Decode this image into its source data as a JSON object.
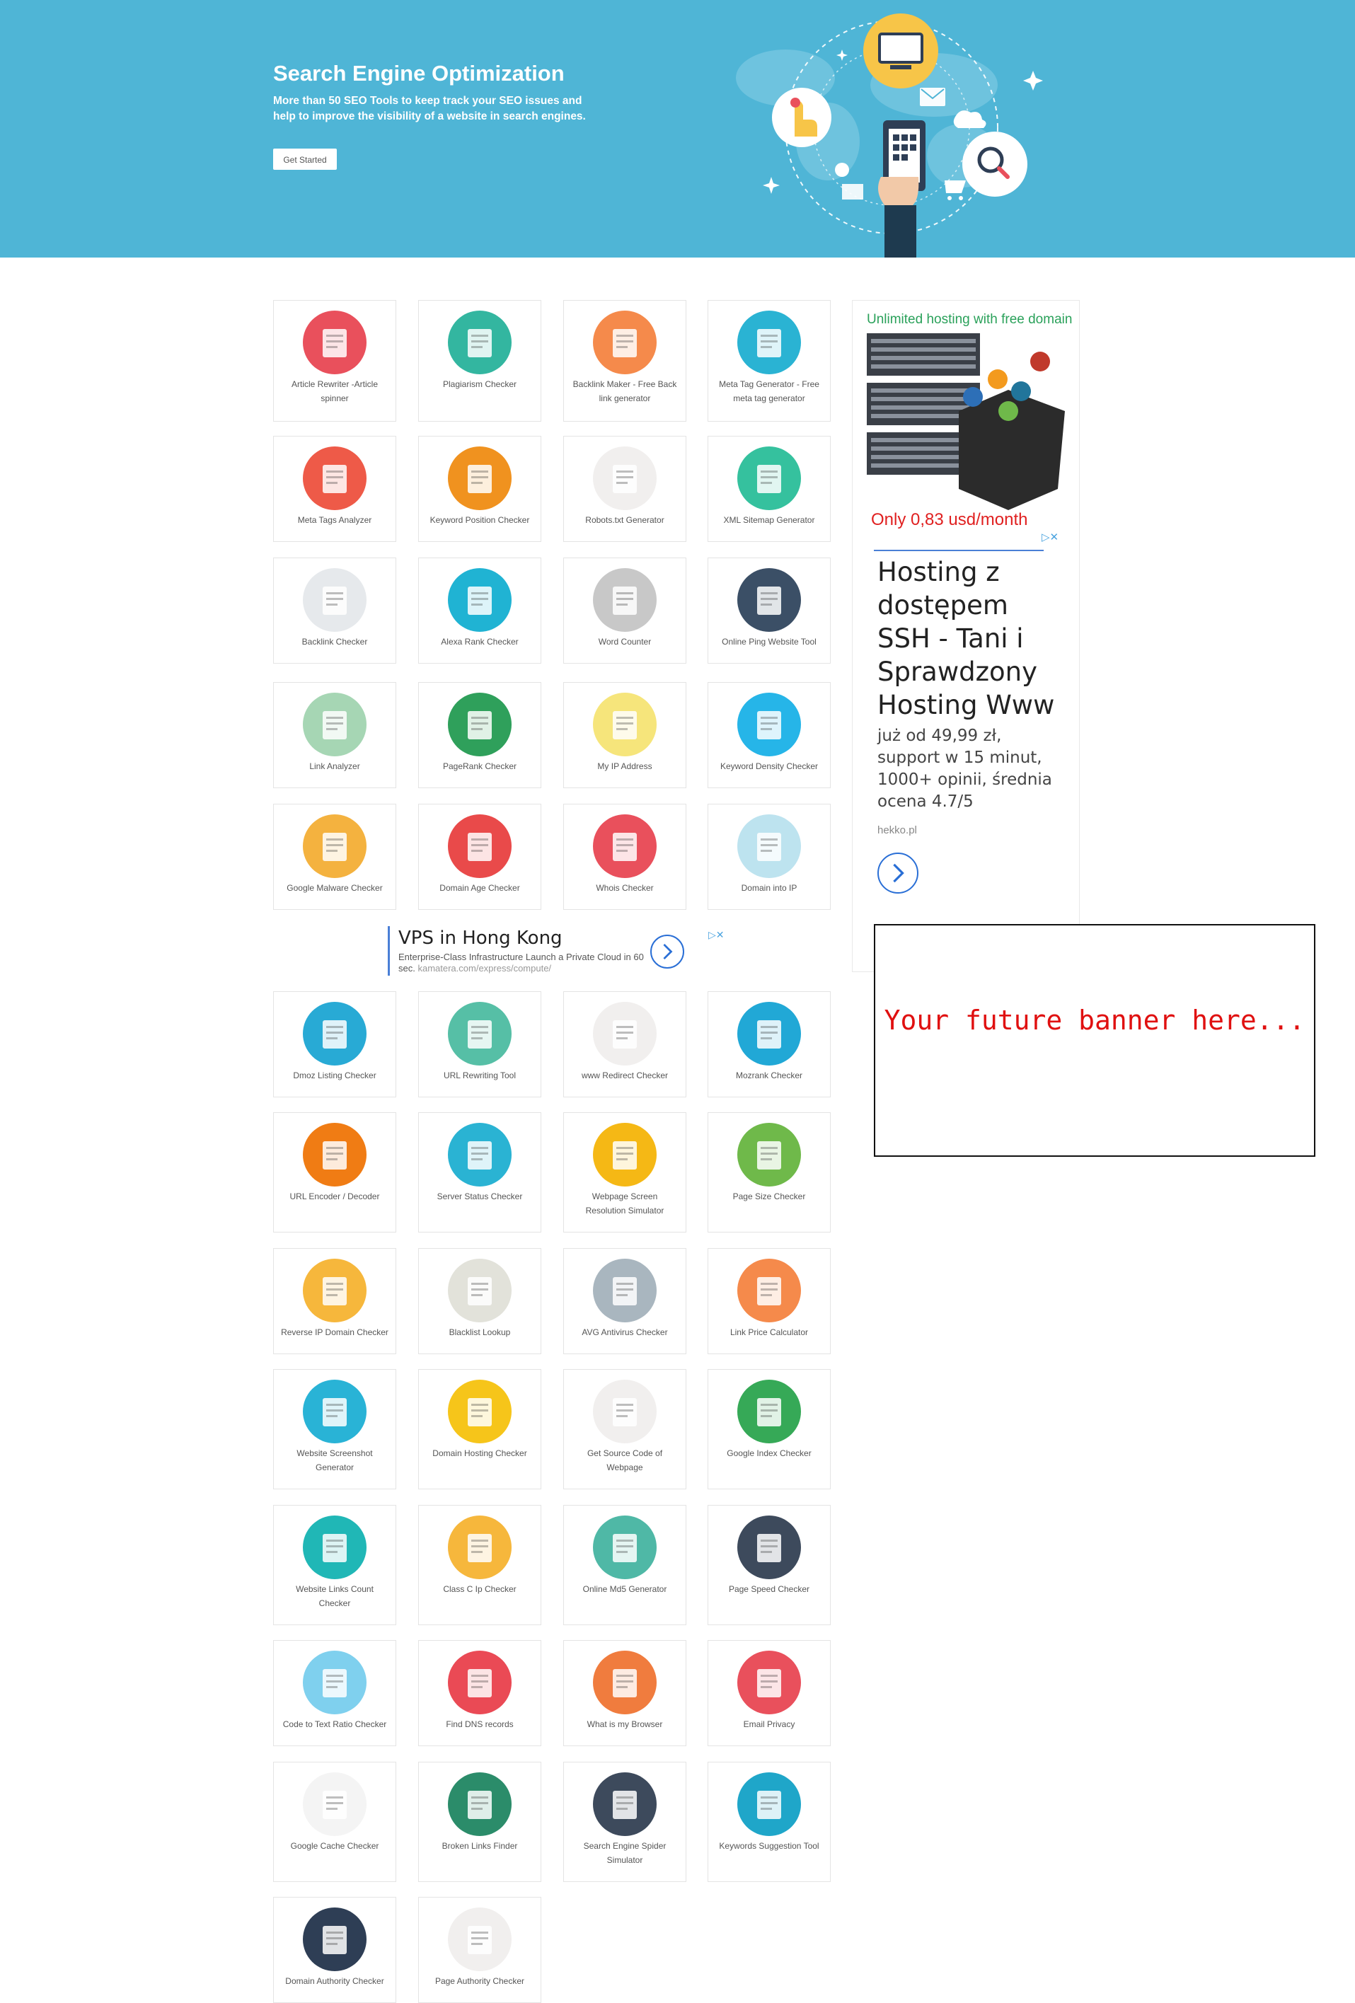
{
  "hero": {
    "title": "Search Engine Optimization",
    "subtitle": "More than 50 SEO Tools to keep track your SEO issues and help to improve the visibility of a website in search engines.",
    "cta": "Get Started",
    "bg_color": "#4fb5d6"
  },
  "tools": [
    {
      "label": "Article Rewriter -Article spinner",
      "icon": "article-rewriter-icon",
      "color": "#e9505c"
    },
    {
      "label": "Plagiarism Checker",
      "icon": "plagiarism-icon",
      "color": "#33b6a0"
    },
    {
      "label": "Backlink Maker - Free Back link generator",
      "icon": "backlink-maker-icon",
      "color": "#f58a4b"
    },
    {
      "label": "Meta Tag Generator - Free meta tag generator",
      "icon": "meta-tag-generator-icon",
      "color": "#2ab3d3"
    },
    {
      "label": "Meta Tags Analyzer",
      "icon": "code-icon",
      "color": "#ee5a48"
    },
    {
      "label": "Keyword Position Checker",
      "icon": "keyword-position-icon",
      "color": "#f0921f"
    },
    {
      "label": "Robots.txt Generator",
      "icon": "robot-bug-icon",
      "color": "#f1efee"
    },
    {
      "label": "XML Sitemap Generator",
      "icon": "sitemap-icon",
      "color": "#35c19e"
    },
    {
      "label": "Backlink Checker",
      "icon": "backlink-chart-icon",
      "color": "#e6e9ec"
    },
    {
      "label": "Alexa Rank Checker",
      "icon": "alexa-icon",
      "color": "#20b3d3"
    },
    {
      "label": "Word Counter",
      "icon": "document-icon",
      "color": "#c8c8c8"
    },
    {
      "label": "Online Ping Website Tool",
      "icon": "bar-chart-icon",
      "color": "#3b4f66"
    },
    {
      "label": "Link Analyzer",
      "icon": "link-icon",
      "color": "#a6d6b4"
    },
    {
      "label": "PageRank Checker",
      "icon": "pagerank-icon",
      "color": "#2fa05b"
    },
    {
      "label": "My IP Address",
      "icon": "map-pin-icon",
      "color": "#f6e57b"
    },
    {
      "label": "Keyword Density Checker",
      "icon": "magnifier-icon",
      "color": "#26b5e8"
    },
    {
      "label": "Google Malware Checker",
      "icon": "malware-icon",
      "color": "#f4b23f"
    },
    {
      "label": "Domain Age Checker",
      "icon": "clock-icon",
      "color": "#e94a4a"
    },
    {
      "label": "Whois Checker",
      "icon": "lock-icon",
      "color": "#e9505c"
    },
    {
      "label": "Domain into IP",
      "icon": "globe-ip-icon",
      "color": "#bde3ef"
    },
    {
      "label": "Dmoz Listing Checker",
      "icon": "dmoz-chart-icon",
      "color": "#28aad5"
    },
    {
      "label": "URL Rewriting Tool",
      "icon": "http-icon",
      "color": "#56bfa6"
    },
    {
      "label": "www Redirect Checker",
      "icon": "www-window-icon",
      "color": "#f1efee"
    },
    {
      "label": "Mozrank Checker",
      "icon": "moz-icon",
      "color": "#21a8d6"
    },
    {
      "label": "URL Encoder / Decoder",
      "icon": "www-icon",
      "color": "#f07c14"
    },
    {
      "label": "Server Status Checker",
      "icon": "server-cloud-icon",
      "color": "#2ab3d3"
    },
    {
      "label": "Webpage Screen Resolution Simulator",
      "icon": "devices-icon",
      "color": "#f5b815"
    },
    {
      "label": "Page Size Checker",
      "icon": "download-icon",
      "color": "#6fb94a"
    },
    {
      "label": "Reverse IP Domain Checker",
      "icon": "ip-wifi-icon",
      "color": "#f6b73c"
    },
    {
      "label": "Blacklist Lookup",
      "icon": "blocked-icon",
      "color": "#e2e2da"
    },
    {
      "label": "AVG Antivirus Checker",
      "icon": "shield-icon",
      "color": "#a9b6bf"
    },
    {
      "label": "Link Price Calculator",
      "icon": "coin-hand-icon",
      "color": "#f58a4b"
    },
    {
      "label": "Website Screenshot Generator",
      "icon": "browser-window-icon",
      "color": "#29b3d6"
    },
    {
      "label": "Domain Hosting Checker",
      "icon": "linux-icon",
      "color": "#f6c51a"
    },
    {
      "label": "Get Source Code of Webpage",
      "icon": "html-window-icon",
      "color": "#f1efee"
    },
    {
      "label": "Google Index Checker",
      "icon": "google-search-icon",
      "color": "#36a957"
    },
    {
      "label": "Website Links Count Checker",
      "icon": "links-doc-icon",
      "color": "#20b7b6"
    },
    {
      "label": "Class C Ip Checker",
      "icon": "tools-icon",
      "color": "#f6b73c"
    },
    {
      "label": "Online Md5 Generator",
      "icon": "padlock-icon",
      "color": "#4fb8a6"
    },
    {
      "label": "Page Speed Checker",
      "icon": "rocket-icon",
      "color": "#3d4a5c"
    },
    {
      "label": "Code to Text Ratio Checker",
      "icon": "code-window-icon",
      "color": "#7fd0ee"
    },
    {
      "label": "Find DNS records",
      "icon": "server-rack-icon",
      "color": "#ea4a55"
    },
    {
      "label": "What is my Browser",
      "icon": "browser-icon",
      "color": "#f07c3e"
    },
    {
      "label": "Email Privacy",
      "icon": "at-sign-icon",
      "color": "#e9505c"
    },
    {
      "label": "Google Cache Checker",
      "icon": "google-cache-icon",
      "color": "#f4f4f4"
    },
    {
      "label": "Broken Links Finder",
      "icon": "404-search-icon",
      "color": "#2b8c6a"
    },
    {
      "label": "Search Engine Spider Simulator",
      "icon": "spider-bot-icon",
      "color": "#3d4a5c"
    },
    {
      "label": "Keywords Suggestion Tool",
      "icon": "books-icon",
      "color": "#1fa6c9"
    },
    {
      "label": "Domain Authority Checker",
      "icon": "authority-icon",
      "color": "#2e3e55"
    },
    {
      "label": "Page Authority Checker",
      "icon": "page-icon",
      "color": "#f1efee"
    }
  ],
  "sidebar_ad": {
    "hosting_title": "Unlimited hosting with free domain",
    "hosting_price": "Only 0,83 usd/month",
    "headline": "Hosting z dostępem SSH - Tani i Sprawdzony Hosting Www",
    "body": "już od 49,99 zł, support w 15 minut, 1000+ opinii, średnia ocena 4.7/5",
    "domain": "hekko.pl",
    "adchoices": "▷✕"
  },
  "banner": {
    "text": "Your future banner here..."
  },
  "vps_ad": {
    "title": "VPS in Hong Kong",
    "desc": "Enterprise-Class Infrastructure Launch a Private Cloud in 60 sec.",
    "url": "kamatera.com/express/compute/",
    "adchoices": "▷✕"
  }
}
